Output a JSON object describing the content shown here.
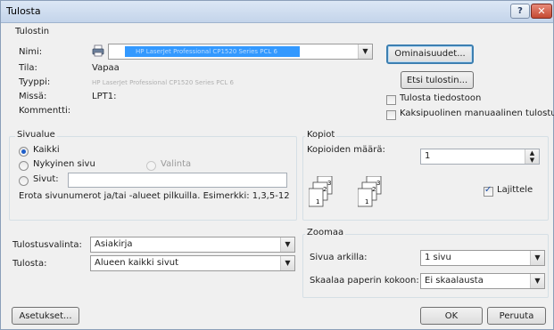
{
  "window": {
    "title": "Tulosta"
  },
  "titlebar": {
    "help": "?",
    "close": "✕"
  },
  "printer": {
    "group_label": "Tulostin",
    "name_label": "Nimi:",
    "name_value": "HP LaserJet Professional CP1520 Series PCL 6",
    "status_label": "Tila:",
    "status_value": "Vapaa",
    "type_label": "Tyyppi:",
    "type_value": "HP LaserJet Professional CP1520 Series PCL 6",
    "where_label": "Missä:",
    "where_value": "LPT1:",
    "comment_label": "Kommentti:",
    "comment_value": "",
    "properties_button": "Ominaisuudet...",
    "find_button": "Etsi tulostin...",
    "print_to_file": "Tulosta tiedostoon",
    "manual_duplex": "Kaksipuolinen manuaalinen tulostus"
  },
  "page_range": {
    "group_label": "Sivualue",
    "all": "Kaikki",
    "current": "Nykyinen sivu",
    "selection": "Valinta",
    "pages": "Sivut:",
    "pages_value": "",
    "hint": "Erota sivunumerot ja/tai -alueet pilkuilla. Esimerkki: 1,3,5-12"
  },
  "copies": {
    "group_label": "Kopiot",
    "count_label": "Kopioiden määrä:",
    "count_value": "1",
    "collate": "Lajittele",
    "page_labels": [
      "1",
      "2",
      "3",
      "1",
      "2",
      "3"
    ]
  },
  "options": {
    "print_what_label": "Tulostusvalinta:",
    "print_what_value": "Asiakirja",
    "print_label": "Tulosta:",
    "print_value": "Alueen kaikki sivut"
  },
  "zoom": {
    "group_label": "Zoomaa",
    "pages_per_sheet_label": "Sivua arkilla:",
    "pages_per_sheet_value": "1 sivu",
    "scale_label": "Skaalaa paperin kokoon:",
    "scale_value": "Ei skaalausta"
  },
  "footer": {
    "settings": "Asetukset...",
    "ok": "OK",
    "cancel": "Peruuta"
  },
  "icons": {
    "printer": "printer-icon",
    "dropdown": "chevron-down-icon",
    "spinner": "spin-icon"
  },
  "colors": {
    "selection": "#3399ff",
    "focus": "#3c7fb1"
  }
}
